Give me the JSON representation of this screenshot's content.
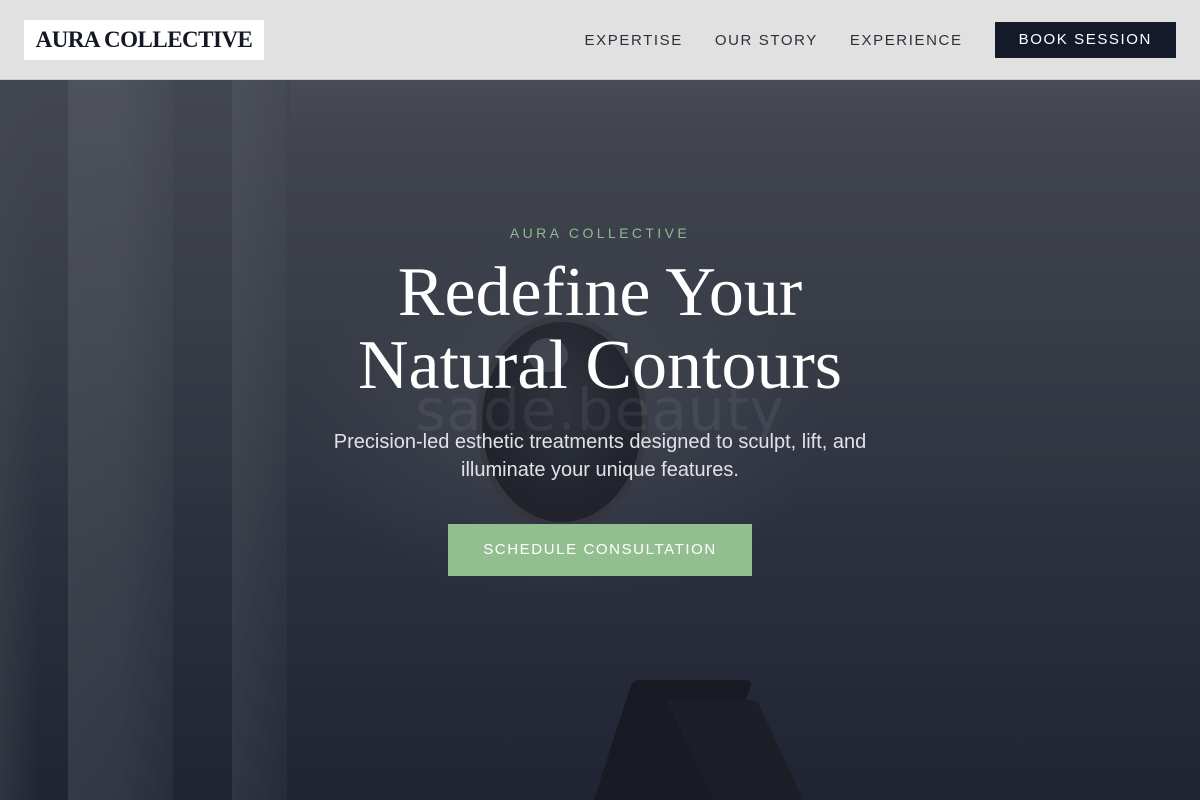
{
  "header": {
    "logo_text": "AURA COLLECTIVE",
    "nav": [
      {
        "label": "EXPERTISE"
      },
      {
        "label": "OUR STORY"
      },
      {
        "label": "EXPERIENCE"
      }
    ],
    "book_button": "BOOK SESSION"
  },
  "hero": {
    "eyebrow": "AURA COLLECTIVE",
    "headline_line1": "Redefine Your",
    "headline_line2": "Natural Contours",
    "subtext_line1": "Precision-led esthetic treatments designed to sculpt, lift, and",
    "subtext_line2": "illuminate your unique features.",
    "cta": "SCHEDULE CONSULTATION",
    "background_watermark": "sade.beauty"
  },
  "colors": {
    "accent_green": "#93be90",
    "navy": "#151a2b",
    "navbar_bg": "#e6e6e6"
  }
}
